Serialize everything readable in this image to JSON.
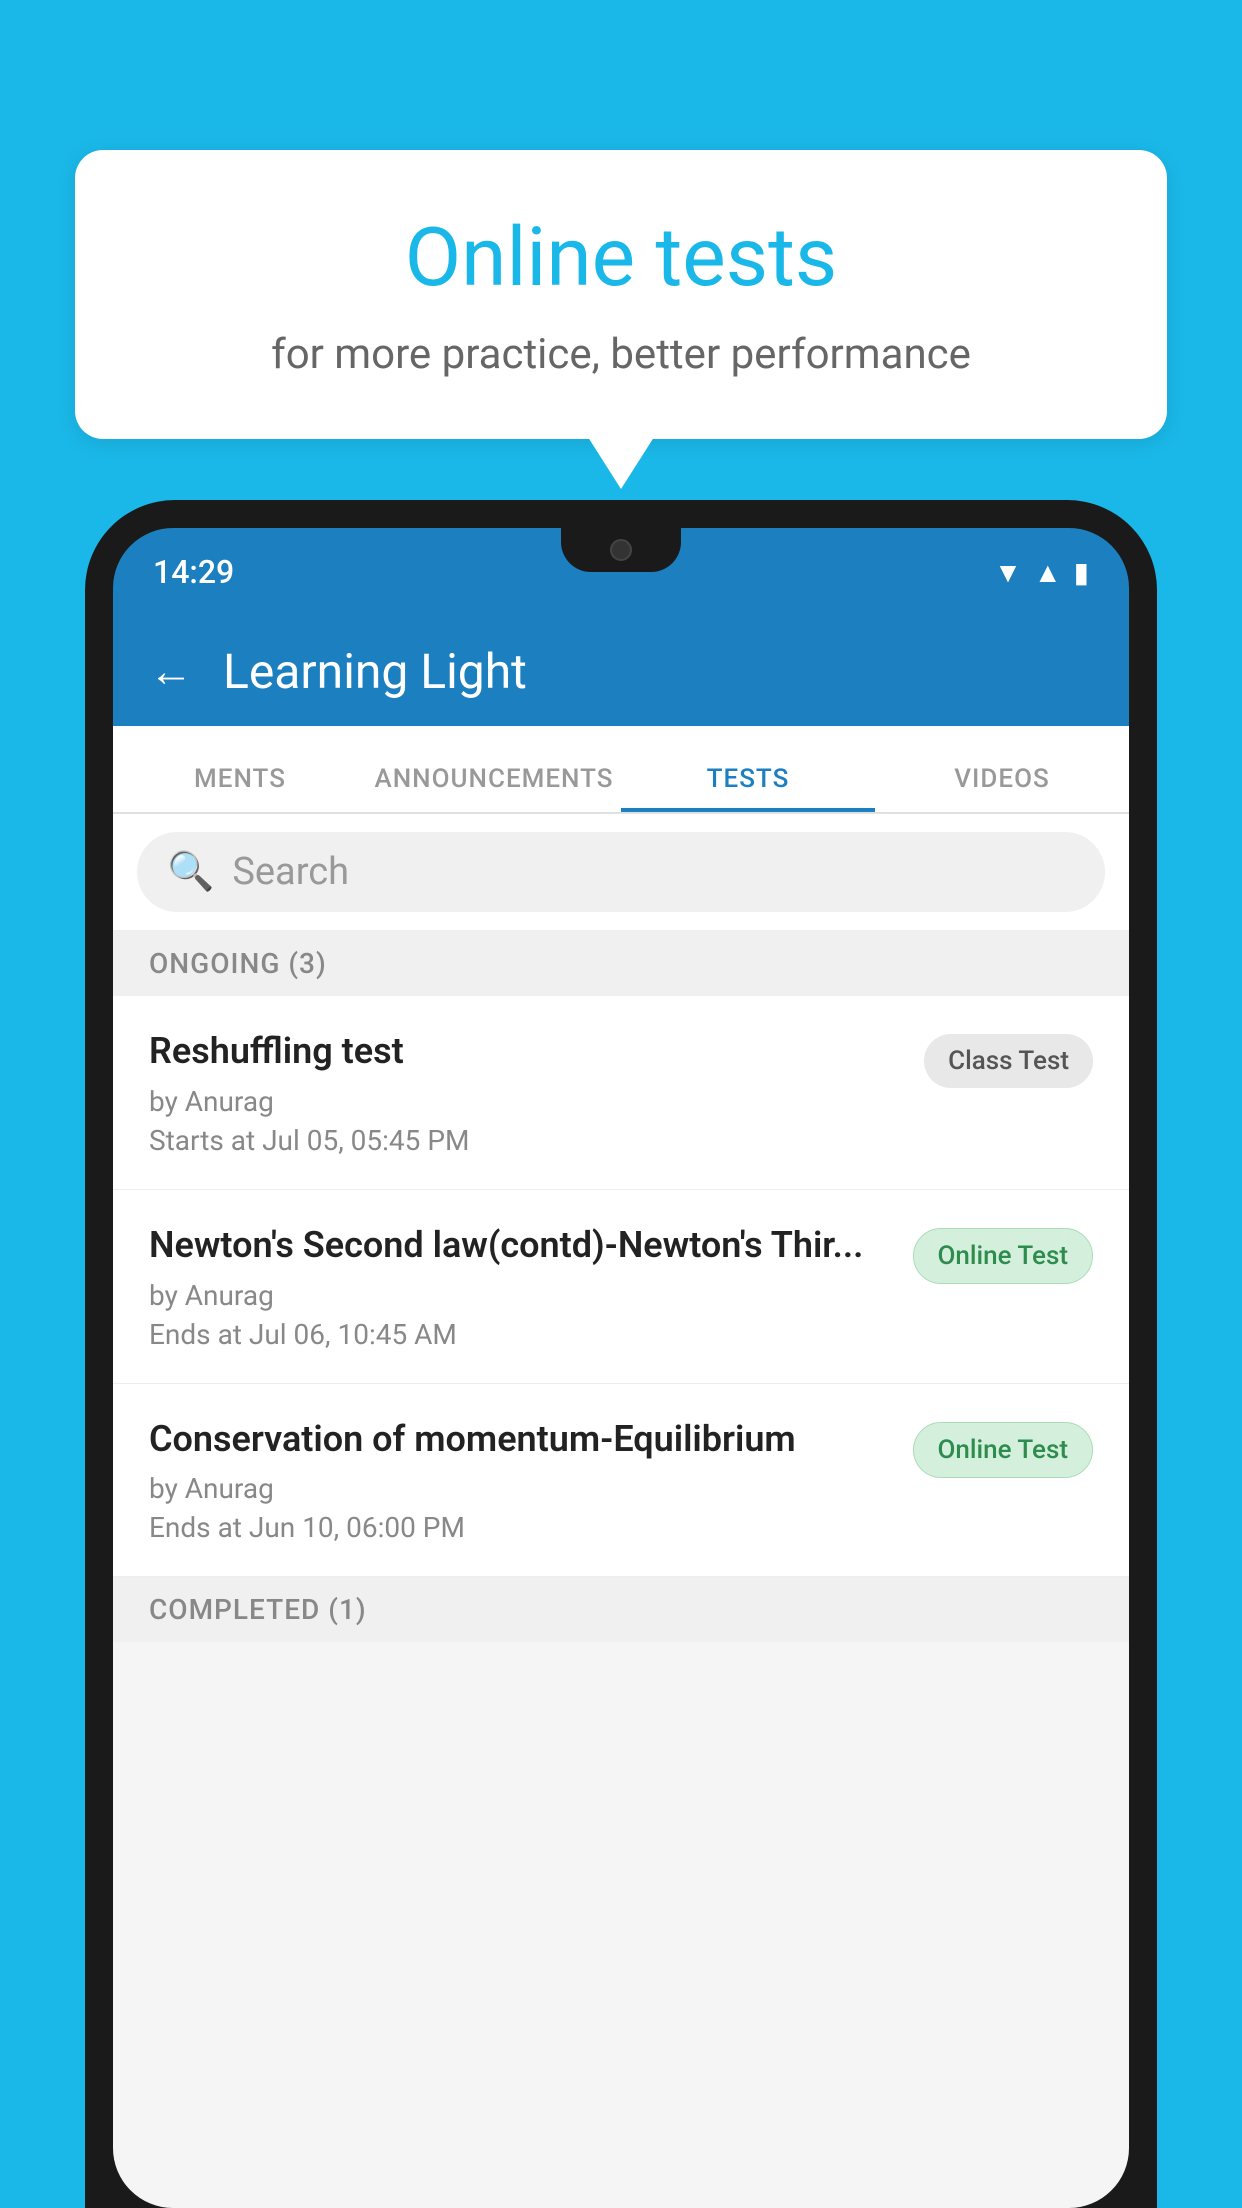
{
  "background": {
    "color": "#1ab8e8"
  },
  "speech_bubble": {
    "title": "Online tests",
    "subtitle": "for more practice, better performance"
  },
  "phone": {
    "status_bar": {
      "time": "14:29"
    },
    "header": {
      "title": "Learning Light",
      "back_label": "←"
    },
    "tabs": [
      {
        "label": "MENTS",
        "active": false
      },
      {
        "label": "ANNOUNCEMENTS",
        "active": false
      },
      {
        "label": "TESTS",
        "active": true
      },
      {
        "label": "VIDEOS",
        "active": false
      }
    ],
    "search": {
      "placeholder": "Search"
    },
    "ongoing_section": {
      "label": "ONGOING (3)"
    },
    "tests": [
      {
        "name": "Reshuffling test",
        "author": "by Anurag",
        "date": "Starts at  Jul 05, 05:45 PM",
        "badge": "Class Test",
        "badge_type": "class"
      },
      {
        "name": "Newton's Second law(contd)-Newton's Thir...",
        "author": "by Anurag",
        "date": "Ends at  Jul 06, 10:45 AM",
        "badge": "Online Test",
        "badge_type": "online"
      },
      {
        "name": "Conservation of momentum-Equilibrium",
        "author": "by Anurag",
        "date": "Ends at  Jun 10, 06:00 PM",
        "badge": "Online Test",
        "badge_type": "online"
      }
    ],
    "completed_section": {
      "label": "COMPLETED (1)"
    }
  }
}
